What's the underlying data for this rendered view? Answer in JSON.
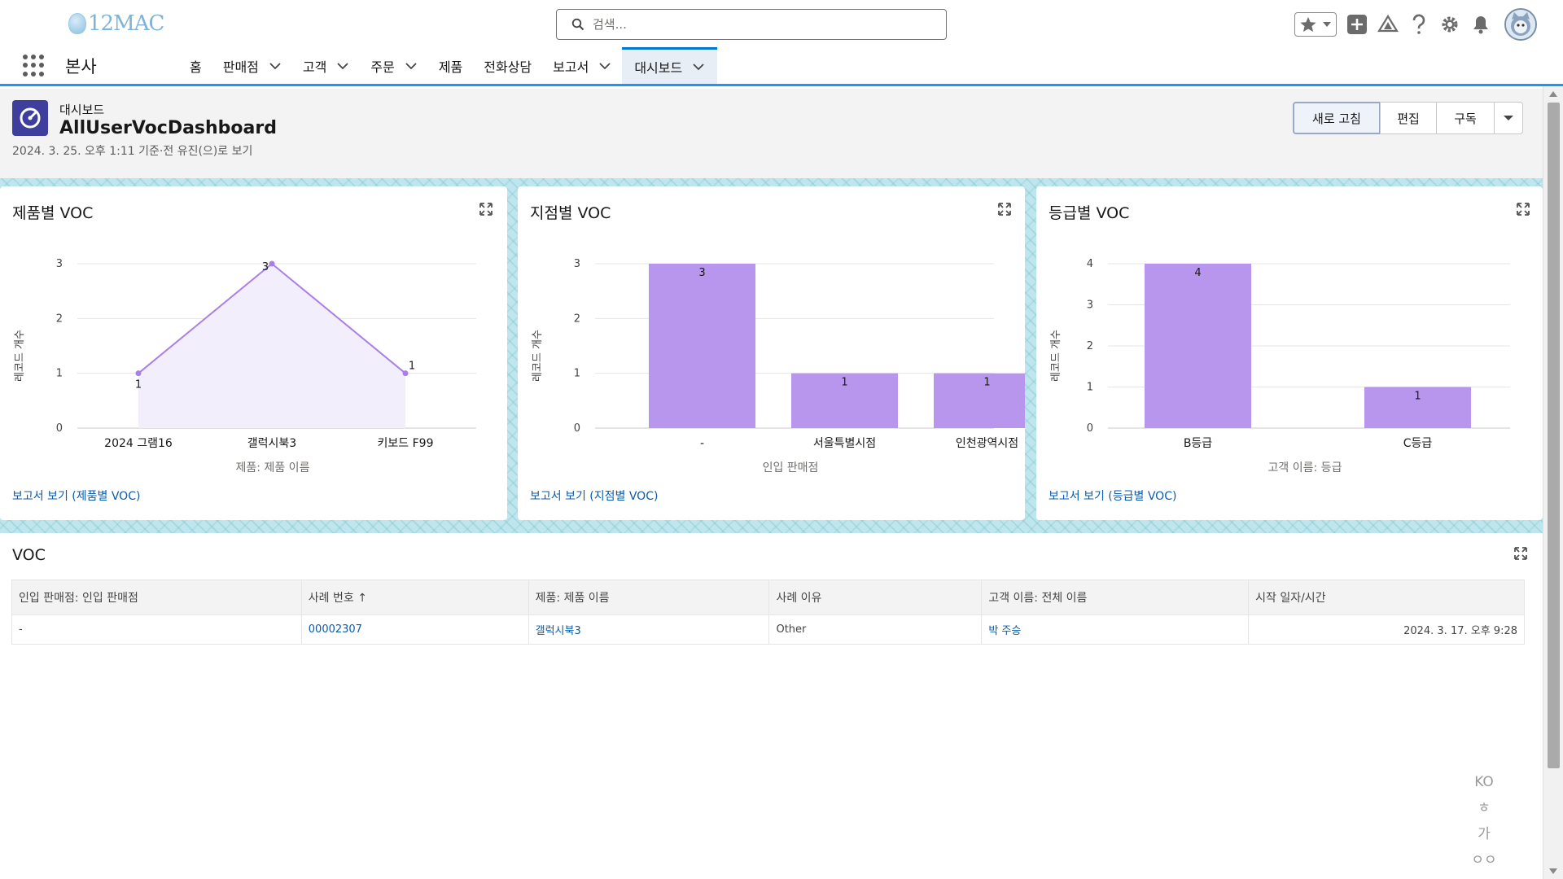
{
  "header": {
    "logo_text": "12MAC",
    "search_placeholder": "검색..."
  },
  "nav": {
    "app_name": "본사",
    "items": [
      {
        "label": "홈",
        "dropdown": false
      },
      {
        "label": "판매점",
        "dropdown": true
      },
      {
        "label": "고객",
        "dropdown": true
      },
      {
        "label": "주문",
        "dropdown": true
      },
      {
        "label": "제품",
        "dropdown": false
      },
      {
        "label": "전화상담",
        "dropdown": false
      },
      {
        "label": "보고서",
        "dropdown": true
      },
      {
        "label": "대시보드",
        "dropdown": true,
        "active": true
      }
    ]
  },
  "page": {
    "object_label": "대시보드",
    "title": "AllUserVocDashboard",
    "meta": "2024. 3. 25. 오후 1:11 기준·전 유진(으)로 보기",
    "buttons": {
      "refresh": "새로 고침",
      "edit": "편집",
      "subscribe": "구독"
    }
  },
  "colors": {
    "accent": "#0176d3",
    "bar": "#b996ee",
    "line": "#a97fe8",
    "area": "#f3eefc",
    "link": "#0b5cab"
  },
  "chart_data": [
    {
      "type": "line",
      "title": "제품별 VOC",
      "xlabel": "제품: 제품 이름",
      "ylabel": "레코드 개수",
      "categories": [
        "2024 그램16",
        "갤럭시북3",
        "키보드 F99"
      ],
      "values": [
        1,
        3,
        1
      ],
      "ylim": [
        0,
        3
      ],
      "yticks": [
        0,
        1,
        2,
        3
      ],
      "link": "보고서 보기 (제품별 VOC)"
    },
    {
      "type": "bar",
      "title": "지점별 VOC",
      "xlabel": "인입 판매점",
      "ylabel": "레코드 개수",
      "categories": [
        "-",
        "서울특별시점",
        "인천광역시점"
      ],
      "values": [
        3,
        1,
        1
      ],
      "ylim": [
        0,
        3
      ],
      "yticks": [
        0,
        1,
        2,
        3
      ],
      "link": "보고서 보기 (지점별 VOC)"
    },
    {
      "type": "bar",
      "title": "등급별 VOC",
      "xlabel": "고객 이름: 등급",
      "ylabel": "레코드 개수",
      "categories": [
        "B등급",
        "C등급"
      ],
      "values": [
        4,
        1
      ],
      "ylim": [
        0,
        4
      ],
      "yticks": [
        0,
        1,
        2,
        3,
        4
      ],
      "link": "보고서 보기 (등급별 VOC)"
    }
  ],
  "voc_table": {
    "title": "VOC",
    "columns": [
      "인입 판매점: 인입 판매점",
      "사례 번호 ↑",
      "제품: 제품 이름",
      "사례 이유",
      "고객 이름: 전체 이름",
      "시작 일자/시간"
    ],
    "rows": [
      [
        "-",
        "00002307",
        "갤럭시북3",
        "Other",
        "박 주승",
        "2024. 3. 17. 오후 9:28"
      ]
    ]
  },
  "ime": {
    "items": [
      "KO",
      "ㅎ",
      "가",
      "ㅇㅇ"
    ]
  }
}
